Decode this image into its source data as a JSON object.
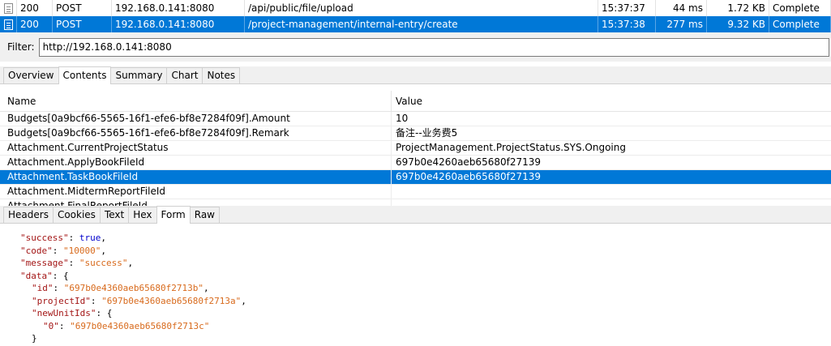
{
  "requests": [
    {
      "status": "200",
      "method": "POST",
      "host": "192.168.0.141:8080",
      "url": "/api/public/file/upload",
      "time": "15:37:37",
      "duration": "44 ms",
      "size": "1.72 KB",
      "result": "Complete"
    },
    {
      "status": "200",
      "method": "POST",
      "host": "192.168.0.141:8080",
      "url": "/project-management/internal-entry/create",
      "time": "15:37:38",
      "duration": "277 ms",
      "size": "9.32 KB",
      "result": "Complete"
    }
  ],
  "filter": {
    "label": "Filter:",
    "value": "http://192.168.0.141:8080"
  },
  "top_tabs": [
    "Overview",
    "Contents",
    "Summary",
    "Chart",
    "Notes"
  ],
  "top_tabs_active": "Contents",
  "grid": {
    "headers": {
      "name": "Name",
      "value": "Value"
    },
    "rows": [
      {
        "name": "Budgets[0a9bcf66-5565-16f1-efe6-bf8e7284f09f].Amount",
        "value": "10"
      },
      {
        "name": "Budgets[0a9bcf66-5565-16f1-efe6-bf8e7284f09f].Remark",
        "value": "备注--业务费5"
      },
      {
        "name": "Attachment.CurrentProjectStatus",
        "value": "ProjectManagement.ProjectStatus.SYS.Ongoing"
      },
      {
        "name": "Attachment.ApplyBookFileId",
        "value": "697b0e4260aeb65680f27139"
      },
      {
        "name": "Attachment.TaskBookFileId",
        "value": "697b0e4260aeb65680f27139"
      },
      {
        "name": "Attachment.MidtermReportFileId",
        "value": ""
      },
      {
        "name": "Attachment.FinalReportFileId",
        "value": ""
      }
    ],
    "selected_row": 4
  },
  "bottom_tabs": [
    "Headers",
    "Cookies",
    "Text",
    "Hex",
    "Form",
    "Raw"
  ],
  "bottom_tabs_active": "Form",
  "json_lines": [
    {
      "indent": 0,
      "key": "\"success\"",
      "value": "true",
      "vtype": "b",
      "tail": ","
    },
    {
      "indent": 0,
      "key": "\"code\"",
      "value": "\"10000\"",
      "vtype": "s",
      "tail": ","
    },
    {
      "indent": 0,
      "key": "\"message\"",
      "value": "\"success\"",
      "vtype": "s",
      "tail": ","
    },
    {
      "indent": 0,
      "key": "\"data\"",
      "value": "{",
      "vtype": "p",
      "tail": ""
    },
    {
      "indent": 1,
      "key": "\"id\"",
      "value": "\"697b0e4360aeb65680f2713b\"",
      "vtype": "s",
      "tail": ","
    },
    {
      "indent": 1,
      "key": "\"projectId\"",
      "value": "\"697b0e4360aeb65680f2713a\"",
      "vtype": "s",
      "tail": ","
    },
    {
      "indent": 1,
      "key": "\"newUnitIds\"",
      "value": "{",
      "vtype": "p",
      "tail": ""
    },
    {
      "indent": 2,
      "key": "\"0\"",
      "value": "\"697b0e4360aeb65680f2713c\"",
      "vtype": "s",
      "tail": ""
    },
    {
      "indent": 1,
      "key": "",
      "value": "}",
      "vtype": "p",
      "tail": ""
    }
  ]
}
